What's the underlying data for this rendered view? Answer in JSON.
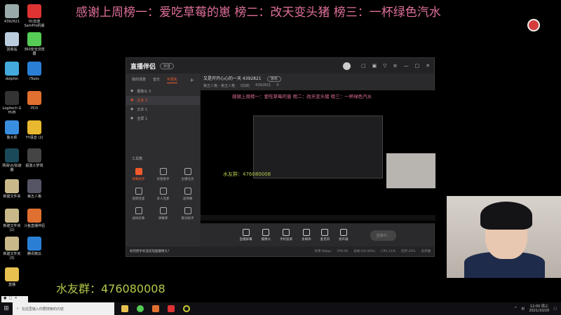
{
  "banner": "感谢上周榜一：爱吃草莓的崽 榜二：改天变头猪 榜三：一杯绿色汽水",
  "desktop_icons": [
    {
      "label": "4392821",
      "color": "#9aa"
    },
    {
      "label": "91音游 SamPro机版",
      "color": "#d33"
    },
    {
      "label": "回收站",
      "color": "#bcd"
    },
    {
      "label": "360安全浏览器",
      "color": "#5c5"
    },
    {
      "label": "dolphin",
      "color": "#4ad"
    },
    {
      "label": "iTools",
      "color": "#2a7fd4"
    },
    {
      "label": "Logitech G HUB",
      "color": "#333"
    },
    {
      "label": "PD3",
      "color": "#e07030"
    },
    {
      "label": "鲁大师",
      "color": "#3a8ee0"
    },
    {
      "label": "YY语音 (2)",
      "color": "#e8b830"
    },
    {
      "label": "网易UU加速器",
      "color": "#1a4a5a"
    },
    {
      "label": "超激斗梦境",
      "color": "#444"
    },
    {
      "label": "新建文件夹",
      "color": "#c9b98a"
    },
    {
      "label": "第五人格",
      "color": "#556"
    },
    {
      "label": "新建文件夹 (2)",
      "color": "#c9b98a"
    },
    {
      "label": "斗鱼直播伴侣",
      "color": "#e07030"
    },
    {
      "label": "新建文件夹 (3)",
      "color": "#c9b98a"
    },
    {
      "label": "腾讯微云",
      "color": "#2a7fd4"
    },
    {
      "label": "直播",
      "color": "#e8c050"
    }
  ],
  "app": {
    "logo": "直播伴侣",
    "badge": "抖音",
    "tabs": [
      "我的场景",
      "音乐",
      "可视化"
    ],
    "scenes": [
      "摄像头 3",
      "文本 2",
      "文本 1",
      "全屏 1"
    ],
    "stream_title": "又是开开心心的一天 4392821",
    "tag": "游戏",
    "category": "第五人格 - 第五人格",
    "user": "QQ的",
    "room_id": "4392821",
    "viewers": "4",
    "toolbox_title": "工具箱",
    "tools": [
      "弹幕助手",
      "房管助手",
      "主播任务",
      "视频连麦",
      "多人连麦",
      "波弹幕",
      "虚拟形象",
      "弹幕库",
      "歌词助手"
    ],
    "controls": [
      "直播屏幕",
      "摄像头",
      "手机投屏",
      "多媒体",
      "麦克风",
      "扬声器"
    ],
    "go_live": "直播中...",
    "tip": "如何把手机变成电脑摄像头?",
    "status": [
      "码率:0kbps",
      "FPS:00",
      "丢帧:0(0.00%)",
      "CPU:11%",
      "内存:20%",
      "未开播"
    ]
  },
  "qq_group": "水友群：476080008",
  "preview_qq": "水友群：476080008",
  "taskbar": {
    "search_placeholder": "在这里输入你要搜索的内容",
    "time": "12:00 周三",
    "date": "2021/10/20",
    "ime": "中"
  }
}
